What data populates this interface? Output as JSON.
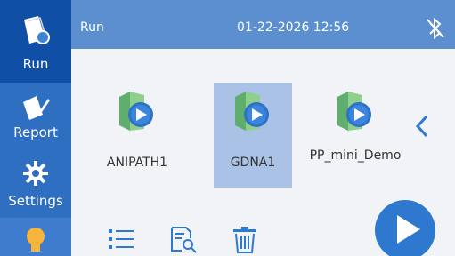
{
  "sidebar": {
    "items": [
      {
        "label": "Run",
        "icon": "run-document-icon"
      },
      {
        "label": "Report",
        "icon": "report-edit-icon"
      },
      {
        "label": "Settings",
        "icon": "gear-icon"
      },
      {
        "label": "",
        "icon": "lightbulb-icon"
      }
    ]
  },
  "header": {
    "title": "Run",
    "datetime": "01-22-2026 12:56",
    "status_icon": "bluetooth-off-icon"
  },
  "files": [
    {
      "name": "ANIPATH1",
      "selected": false
    },
    {
      "name": "GDNA1",
      "selected": true
    },
    {
      "name": "PP_mini_Demo",
      "selected": false
    }
  ],
  "toolbar": {
    "icons": [
      "list-icon",
      "search-document-icon",
      "trash-icon"
    ]
  },
  "actions": {
    "play_icon": "play-icon"
  },
  "colors": {
    "sidebar": "#2f6fc2",
    "sidebar_active": "#0f4fa6",
    "header": "#5b8fd0",
    "accent": "#2e78d0",
    "selected": "#a9c2e6"
  }
}
